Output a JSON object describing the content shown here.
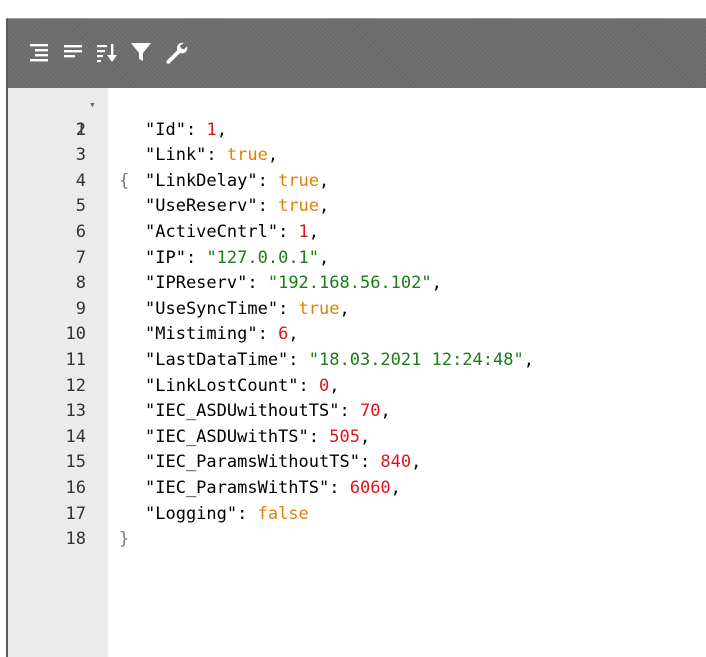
{
  "toolbar": {
    "buttons": [
      {
        "name": "format-button",
        "icon": "format-icon"
      },
      {
        "name": "compact-button",
        "icon": "compact-icon"
      },
      {
        "name": "sort-button",
        "icon": "sort-icon"
      },
      {
        "name": "filter-button",
        "icon": "filter-icon"
      },
      {
        "name": "repair-button",
        "icon": "wrench-icon"
      }
    ]
  },
  "editor": {
    "line_numbers": [
      "1",
      "2",
      "3",
      "4",
      "5",
      "6",
      "7",
      "8",
      "9",
      "10",
      "11",
      "12",
      "13",
      "14",
      "15",
      "16",
      "17",
      "18"
    ],
    "open_brace": "{",
    "close_brace": "}",
    "entries": [
      {
        "key": "\"Id\"",
        "value": "1",
        "type": "number",
        "comma": ","
      },
      {
        "key": "\"Link\"",
        "value": "true",
        "type": "boolean",
        "comma": ","
      },
      {
        "key": "\"LinkDelay\"",
        "value": "true",
        "type": "boolean",
        "comma": ","
      },
      {
        "key": "\"UseReserv\"",
        "value": "true",
        "type": "boolean",
        "comma": ","
      },
      {
        "key": "\"ActiveCntrl\"",
        "value": "1",
        "type": "number",
        "comma": ","
      },
      {
        "key": "\"IP\"",
        "value": "\"127.0.0.1\"",
        "type": "string",
        "comma": ","
      },
      {
        "key": "\"IPReserv\"",
        "value": "\"192.168.56.102\"",
        "type": "string",
        "comma": ","
      },
      {
        "key": "\"UseSyncTime\"",
        "value": "true",
        "type": "boolean",
        "comma": ","
      },
      {
        "key": "\"Mistiming\"",
        "value": "6",
        "type": "number",
        "comma": ","
      },
      {
        "key": "\"LastDataTime\"",
        "value": "\"18.03.2021 12:24:48\"",
        "type": "string",
        "comma": ","
      },
      {
        "key": "\"LinkLostCount\"",
        "value": "0",
        "type": "number",
        "comma": ","
      },
      {
        "key": "\"IEC_ASDUwithoutTS\"",
        "value": "70",
        "type": "number",
        "comma": ","
      },
      {
        "key": "\"IEC_ASDUwithTS\"",
        "value": "505",
        "type": "number",
        "comma": ","
      },
      {
        "key": "\"IEC_ParamsWithoutTS\"",
        "value": "840",
        "type": "number",
        "comma": ","
      },
      {
        "key": "\"IEC_ParamsWithTS\"",
        "value": "6060",
        "type": "number",
        "comma": ","
      },
      {
        "key": "\"Logging\"",
        "value": "false",
        "type": "boolean",
        "comma": ""
      }
    ]
  },
  "colors": {
    "toolbar_bg": "#6b6b6b",
    "gutter_bg": "#ebebeb",
    "number": "#e0141e",
    "boolean": "#e08000",
    "string": "#1a7d1a"
  }
}
